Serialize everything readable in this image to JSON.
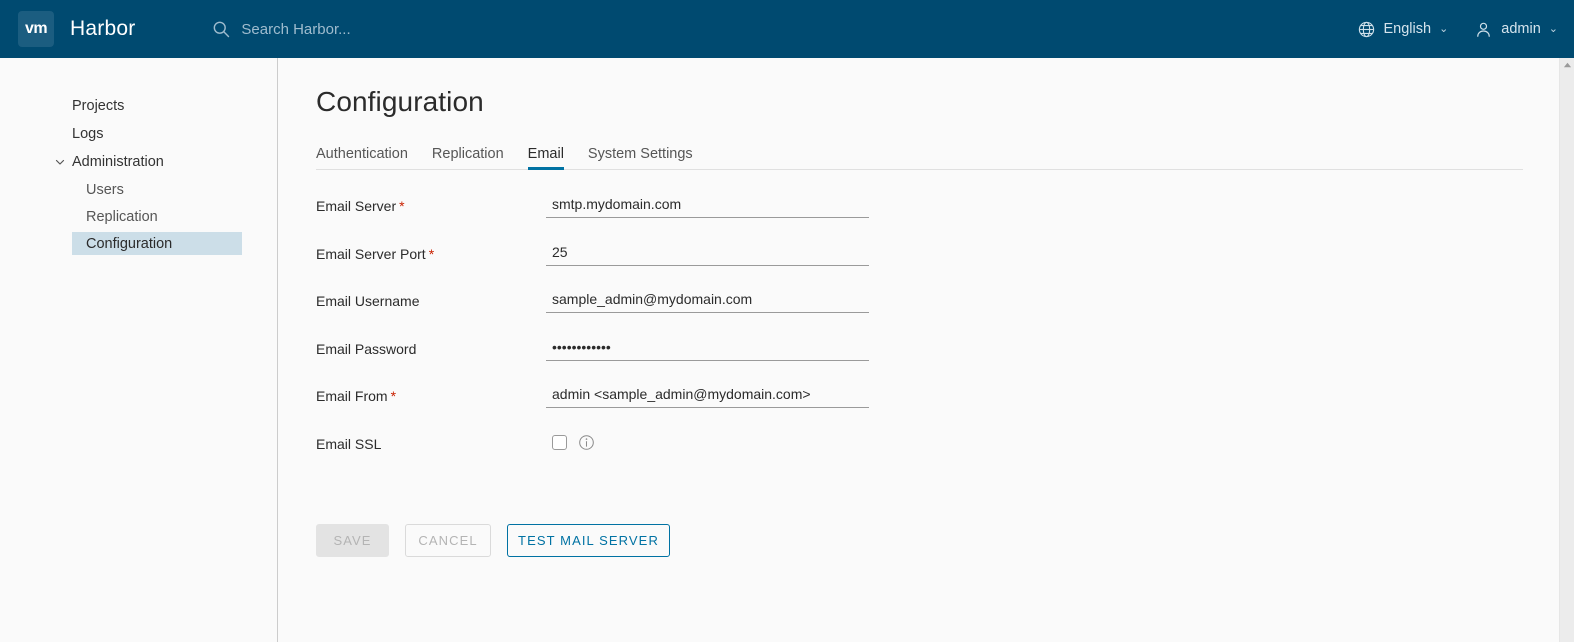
{
  "header": {
    "logo_text": "vm",
    "logo_icon": "vmware-logo-icon",
    "brand": "Harbor",
    "search": {
      "icon": "search-icon",
      "placeholder": "Search Harbor..."
    },
    "language": {
      "icon": "globe-icon",
      "label": "English",
      "caret": "⌄"
    },
    "user": {
      "icon": "user-icon",
      "label": "admin",
      "caret": "⌄"
    },
    "bg_color": "#004a70"
  },
  "sidebar": {
    "items": [
      {
        "label": "Projects",
        "level": "top",
        "selected": false
      },
      {
        "label": "Logs",
        "level": "top",
        "selected": false
      },
      {
        "label": "Administration",
        "level": "top",
        "selected": false,
        "icon": "chevron-down-icon",
        "expanded": true
      },
      {
        "label": "Users",
        "level": "sub",
        "selected": false
      },
      {
        "label": "Replication",
        "level": "sub",
        "selected": false
      },
      {
        "label": "Configuration",
        "level": "sub",
        "selected": true
      }
    ],
    "selected_bg": "#ccdee8"
  },
  "main": {
    "title": "Configuration",
    "tabs": [
      {
        "label": "Authentication",
        "active": false
      },
      {
        "label": "Replication",
        "active": false
      },
      {
        "label": "Email",
        "active": true
      },
      {
        "label": "System Settings",
        "active": false
      }
    ],
    "accent_color": "#0072a3",
    "form": {
      "fields": [
        {
          "label": "Email Server",
          "required": true,
          "value": "smtp.mydomain.com",
          "type": "text",
          "name": "email-server"
        },
        {
          "label": "Email Server Port",
          "required": true,
          "value": "25",
          "type": "text",
          "name": "email-server-port"
        },
        {
          "label": "Email Username",
          "required": false,
          "value": "sample_admin@mydomain.com",
          "type": "text",
          "name": "email-username"
        },
        {
          "label": "Email Password",
          "required": false,
          "value": "••••••••••••",
          "type": "password",
          "name": "email-password"
        },
        {
          "label": "Email From",
          "required": true,
          "value": "admin <sample_admin@mydomain.com>",
          "type": "text",
          "name": "email-from"
        }
      ],
      "ssl": {
        "label": "Email SSL",
        "checked": false,
        "info_icon": "info-circle-icon"
      },
      "required_marker": "*"
    },
    "buttons": {
      "save": "SAVE",
      "cancel": "CANCEL",
      "test": "TEST MAIL SERVER"
    }
  },
  "scrollbar": {
    "up_arrow_icon": "scroll-up-arrow-icon"
  }
}
